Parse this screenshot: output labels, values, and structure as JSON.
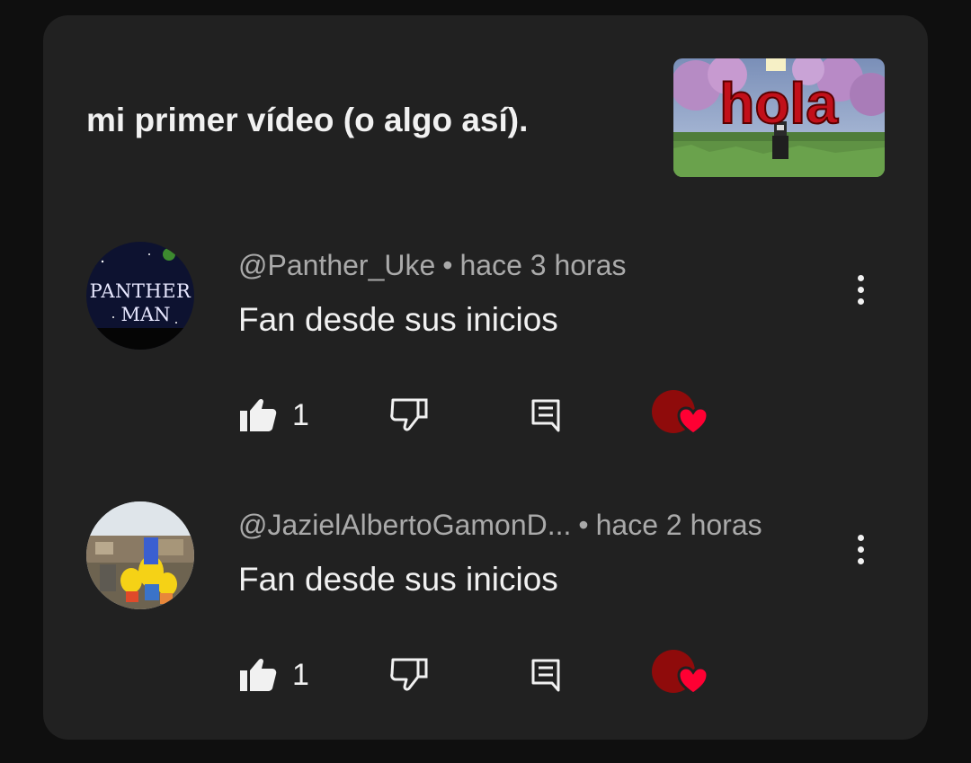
{
  "video": {
    "title": "mi primer vídeo (o algo así).",
    "thumbnail_text": "hola"
  },
  "comments": [
    {
      "handle": "@Panther_Uke",
      "time": "hace 3 horas",
      "text": "Fan desde sus inicios",
      "like_count": "1",
      "avatar_text_line1": "PANTHER",
      "avatar_text_line2": "MAN",
      "hearted": true
    },
    {
      "handle": "@JazielAlbertoGamonD...",
      "time": "hace 2 horas",
      "text": "Fan desde sus inicios",
      "like_count": "1",
      "hearted": true
    }
  ],
  "icons": {
    "like": "thumbs-up-icon",
    "dislike": "thumbs-down-icon",
    "reply": "reply-comment-icon",
    "more": "more-vertical-icon",
    "heart": "creator-heart-icon"
  },
  "colors": {
    "background": "#0f0f0f",
    "card": "#212121",
    "primary_text": "#f1f1f1",
    "secondary_text": "#aaaaaa",
    "heart_red": "#ff0033",
    "creator_avatar": "#8f0b0b"
  },
  "separator": "•"
}
